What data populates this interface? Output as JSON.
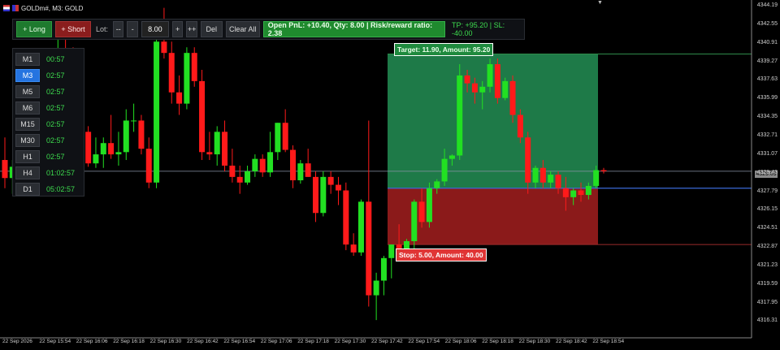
{
  "window": {
    "title": "GOLDm#, M3: GOLD"
  },
  "toolbar": {
    "long_label": "+ Long",
    "short_label": "+ Short",
    "lot_label": "Lot:",
    "dec_big": "--",
    "dec": "-",
    "lot_value": "8.00",
    "inc": "+",
    "inc_big": "++",
    "del_label": "Del",
    "clear_label": "Clear All",
    "pnl_text": "Open PnL: +10.40, Qty: 8.00 | Risk/reward ratio: 2.38",
    "tp_sl_text": "TP: +95.20 | SL: -40.00"
  },
  "timeframes": [
    {
      "label": "M1",
      "time": "00:57",
      "active": false
    },
    {
      "label": "M3",
      "time": "02:57",
      "active": true
    },
    {
      "label": "M5",
      "time": "02:57",
      "active": false
    },
    {
      "label": "M6",
      "time": "02:57",
      "active": false
    },
    {
      "label": "M15",
      "time": "02:57",
      "active": false
    },
    {
      "label": "M30",
      "time": "02:57",
      "active": false
    },
    {
      "label": "H1",
      "time": "02:57",
      "active": false
    },
    {
      "label": "H4",
      "time": "01:02:57",
      "active": false
    },
    {
      "label": "D1",
      "time": "05:02:57",
      "active": false
    }
  ],
  "target_tag": "Target: 11.90, Amount: 95.20",
  "stop_tag": "Stop: 5.00, Amount: 40.00",
  "current_price": "4329.09",
  "price_labels": [
    "4344.19",
    "4342.55",
    "4340.91",
    "4339.27",
    "4337.63",
    "4335.99",
    "4334.35",
    "4332.71",
    "4331.07",
    "4329.43",
    "4327.79",
    "4326.15",
    "4324.51",
    "4322.87",
    "4321.23",
    "4319.59",
    "4317.95",
    "4316.31"
  ],
  "time_labels": [
    "22 Sep 2026",
    "22 Sep 15:54",
    "22 Sep 16:06",
    "22 Sep 16:18",
    "22 Sep 16:30",
    "22 Sep 16:42",
    "22 Sep 16:54",
    "22 Sep 17:06",
    "22 Sep 17:18",
    "22 Sep 17:30",
    "22 Sep 17:42",
    "22 Sep 17:54",
    "22 Sep 18:06",
    "22 Sep 18:18",
    "22 Sep 18:30",
    "22 Sep 18:42",
    "22 Sep 18:54"
  ],
  "colors": {
    "bull": "#22e022",
    "bear": "#ff1a1a",
    "target_zone": "#1e7a48",
    "stop_zone": "#8b1a1a",
    "entry_line": "#3a6ad8"
  },
  "chart_data": {
    "type": "candlestick",
    "price_axis": {
      "min": 4316.31,
      "max": 4344.19
    },
    "entry_price": 4328.0,
    "target_price": 4339.9,
    "stop_price": 4323.0,
    "candles": [
      {
        "o": 4330.5,
        "h": 4332.5,
        "l": 4328.0,
        "c": 4328.9
      },
      {
        "o": 4328.9,
        "h": 4330.5,
        "l": 4327.5,
        "c": 4329.9
      },
      {
        "o": 4329.9,
        "h": 4333.0,
        "l": 4328.8,
        "c": 4331.8
      },
      {
        "o": 4331.8,
        "h": 4332.0,
        "l": 4329.7,
        "c": 4330.0
      },
      {
        "o": 4330.0,
        "h": 4332.0,
        "l": 4328.5,
        "c": 4331.2
      },
      {
        "o": 4331.2,
        "h": 4332.5,
        "l": 4330.0,
        "c": 4331.2
      },
      {
        "o": 4331.2,
        "h": 4339.5,
        "l": 4330.5,
        "c": 4338.9
      },
      {
        "o": 4338.9,
        "h": 4342.0,
        "l": 4337.0,
        "c": 4340.0
      },
      {
        "o": 4340.0,
        "h": 4341.5,
        "l": 4338.5,
        "c": 4339.2
      },
      {
        "o": 4339.2,
        "h": 4340.5,
        "l": 4337.2,
        "c": 4337.8
      },
      {
        "o": 4337.8,
        "h": 4339.0,
        "l": 4332.0,
        "c": 4333.0
      },
      {
        "o": 4333.0,
        "h": 4333.5,
        "l": 4329.9,
        "c": 4330.2
      },
      {
        "o": 4330.2,
        "h": 4332.5,
        "l": 4329.8,
        "c": 4331.0
      },
      {
        "o": 4331.0,
        "h": 4332.5,
        "l": 4329.8,
        "c": 4332.0
      },
      {
        "o": 4332.0,
        "h": 4334.5,
        "l": 4330.6,
        "c": 4331.0
      },
      {
        "o": 4331.0,
        "h": 4333.0,
        "l": 4330.0,
        "c": 4331.2
      },
      {
        "o": 4331.2,
        "h": 4335.0,
        "l": 4330.5,
        "c": 4334.0
      },
      {
        "o": 4334.0,
        "h": 4335.5,
        "l": 4333.0,
        "c": 4334.0
      },
      {
        "o": 4334.0,
        "h": 4334.5,
        "l": 4331.0,
        "c": 4331.5
      },
      {
        "o": 4331.5,
        "h": 4332.5,
        "l": 4328.0,
        "c": 4328.5
      },
      {
        "o": 4328.5,
        "h": 4342.0,
        "l": 4328.0,
        "c": 4341.0
      },
      {
        "o": 4341.0,
        "h": 4344.0,
        "l": 4339.5,
        "c": 4340.0
      },
      {
        "o": 4340.0,
        "h": 4341.0,
        "l": 4335.5,
        "c": 4336.5
      },
      {
        "o": 4336.5,
        "h": 4338.0,
        "l": 4334.5,
        "c": 4335.5
      },
      {
        "o": 4335.5,
        "h": 4340.5,
        "l": 4335.0,
        "c": 4340.0
      },
      {
        "o": 4340.0,
        "h": 4340.5,
        "l": 4337.0,
        "c": 4337.5
      },
      {
        "o": 4337.5,
        "h": 4338.5,
        "l": 4330.5,
        "c": 4331.2
      },
      {
        "o": 4331.2,
        "h": 4333.0,
        "l": 4330.5,
        "c": 4331.0
      },
      {
        "o": 4331.0,
        "h": 4333.5,
        "l": 4330.0,
        "c": 4333.0
      },
      {
        "o": 4333.0,
        "h": 4334.0,
        "l": 4329.5,
        "c": 4330.0
      },
      {
        "o": 4330.0,
        "h": 4331.5,
        "l": 4328.5,
        "c": 4329.0
      },
      {
        "o": 4329.0,
        "h": 4330.0,
        "l": 4327.5,
        "c": 4328.5
      },
      {
        "o": 4328.5,
        "h": 4330.0,
        "l": 4328.3,
        "c": 4329.5
      },
      {
        "o": 4329.5,
        "h": 4331.0,
        "l": 4329.0,
        "c": 4330.6
      },
      {
        "o": 4330.6,
        "h": 4331.0,
        "l": 4329.0,
        "c": 4329.4
      },
      {
        "o": 4329.4,
        "h": 4333.0,
        "l": 4329.0,
        "c": 4331.2
      },
      {
        "o": 4331.2,
        "h": 4333.8,
        "l": 4330.5,
        "c": 4333.8
      },
      {
        "o": 4333.8,
        "h": 4335.0,
        "l": 4331.2,
        "c": 4331.4
      },
      {
        "o": 4331.4,
        "h": 4331.8,
        "l": 4328.0,
        "c": 4328.7
      },
      {
        "o": 4328.7,
        "h": 4330.5,
        "l": 4328.4,
        "c": 4330.2
      },
      {
        "o": 4330.2,
        "h": 4331.5,
        "l": 4329.0,
        "c": 4329.0
      },
      {
        "o": 4329.0,
        "h": 4329.5,
        "l": 4325.0,
        "c": 4325.8
      },
      {
        "o": 4325.8,
        "h": 4329.5,
        "l": 4325.5,
        "c": 4329.0
      },
      {
        "o": 4329.0,
        "h": 4329.5,
        "l": 4327.5,
        "c": 4328.3
      },
      {
        "o": 4328.3,
        "h": 4329.0,
        "l": 4326.5,
        "c": 4327.8
      },
      {
        "o": 4327.8,
        "h": 4328.5,
        "l": 4322.5,
        "c": 4323.0
      },
      {
        "o": 4323.0,
        "h": 4324.0,
        "l": 4322.0,
        "c": 4322.3
      },
      {
        "o": 4322.3,
        "h": 4327.0,
        "l": 4322.0,
        "c": 4326.8
      },
      {
        "o": 4326.8,
        "h": 4334.0,
        "l": 4317.5,
        "c": 4318.5
      },
      {
        "o": 4318.5,
        "h": 4320.5,
        "l": 4316.3,
        "c": 4319.8
      },
      {
        "o": 4319.8,
        "h": 4322.0,
        "l": 4318.5,
        "c": 4321.8
      },
      {
        "o": 4321.8,
        "h": 4323.0,
        "l": 4320.0,
        "c": 4323.0
      },
      {
        "o": 4323.0,
        "h": 4324.8,
        "l": 4321.5,
        "c": 4322.0
      },
      {
        "o": 4322.0,
        "h": 4323.5,
        "l": 4321.5,
        "c": 4323.3
      },
      {
        "o": 4323.3,
        "h": 4327.0,
        "l": 4322.5,
        "c": 4326.8
      },
      {
        "o": 4326.8,
        "h": 4328.0,
        "l": 4324.5,
        "c": 4325.0
      },
      {
        "o": 4325.0,
        "h": 4328.5,
        "l": 4324.5,
        "c": 4328.0
      },
      {
        "o": 4328.0,
        "h": 4328.8,
        "l": 4327.5,
        "c": 4328.6
      },
      {
        "o": 4328.6,
        "h": 4331.5,
        "l": 4328.2,
        "c": 4330.6
      },
      {
        "o": 4330.6,
        "h": 4331.0,
        "l": 4330.0,
        "c": 4330.9
      },
      {
        "o": 4330.9,
        "h": 4339.0,
        "l": 4330.5,
        "c": 4338.0
      },
      {
        "o": 4338.0,
        "h": 4338.5,
        "l": 4336.5,
        "c": 4337.3
      },
      {
        "o": 4337.3,
        "h": 4337.8,
        "l": 4335.5,
        "c": 4336.5
      },
      {
        "o": 4336.5,
        "h": 4337.5,
        "l": 4335.0,
        "c": 4337.0
      },
      {
        "o": 4337.0,
        "h": 4339.5,
        "l": 4336.5,
        "c": 4339.0
      },
      {
        "o": 4339.0,
        "h": 4339.5,
        "l": 4335.5,
        "c": 4336.0
      },
      {
        "o": 4336.0,
        "h": 4337.8,
        "l": 4335.8,
        "c": 4337.5
      },
      {
        "o": 4337.5,
        "h": 4338.0,
        "l": 4333.8,
        "c": 4334.5
      },
      {
        "o": 4334.5,
        "h": 4335.0,
        "l": 4332.0,
        "c": 4332.5
      },
      {
        "o": 4332.5,
        "h": 4333.0,
        "l": 4327.5,
        "c": 4328.5
      },
      {
        "o": 4328.5,
        "h": 4330.0,
        "l": 4328.0,
        "c": 4329.8
      },
      {
        "o": 4329.8,
        "h": 4330.5,
        "l": 4328.0,
        "c": 4328.5
      },
      {
        "o": 4328.5,
        "h": 4329.5,
        "l": 4328.0,
        "c": 4329.2
      },
      {
        "o": 4329.2,
        "h": 4329.5,
        "l": 4327.5,
        "c": 4328.0
      },
      {
        "o": 4328.0,
        "h": 4329.0,
        "l": 4326.0,
        "c": 4327.2
      },
      {
        "o": 4327.2,
        "h": 4328.0,
        "l": 4326.5,
        "c": 4327.8
      },
      {
        "o": 4327.8,
        "h": 4328.5,
        "l": 4326.8,
        "c": 4327.4
      },
      {
        "o": 4327.4,
        "h": 4328.5,
        "l": 4327.0,
        "c": 4328.2
      },
      {
        "o": 4328.2,
        "h": 4330.0,
        "l": 4328.0,
        "c": 4329.6
      },
      {
        "o": 4329.6,
        "h": 4329.8,
        "l": 4329.3,
        "c": 4329.5
      }
    ]
  }
}
